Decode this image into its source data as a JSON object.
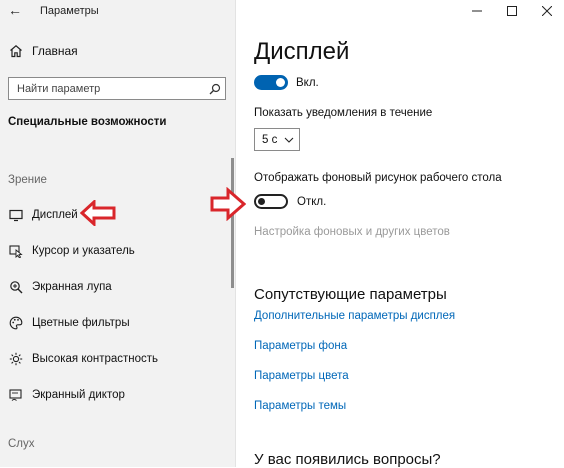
{
  "window": {
    "title": "Параметры",
    "back_glyph": "←"
  },
  "sidebar": {
    "home_label": "Главная",
    "search_placeholder": "Найти параметр",
    "section_heading": "Специальные возможности",
    "groups": [
      {
        "label": "Зрение"
      },
      {
        "label": "Слух"
      }
    ],
    "items": [
      {
        "label": "Дисплей",
        "icon": "monitor-icon"
      },
      {
        "label": "Курсор и указатель",
        "icon": "cursor-icon"
      },
      {
        "label": "Экранная лупа",
        "icon": "magnifier-icon"
      },
      {
        "label": "Цветные фильтры",
        "icon": "palette-icon"
      },
      {
        "label": "Высокая контрастность",
        "icon": "brightness-icon"
      },
      {
        "label": "Экранный диктор",
        "icon": "narrator-icon"
      }
    ]
  },
  "main": {
    "title": "Дисплей",
    "toggle1": {
      "label": "Вкл.",
      "state": "on"
    },
    "notify_label": "Показать уведомления в течение",
    "notify_select": {
      "value": "5 с"
    },
    "bg_label": "Отображать фоновый рисунок рабочего стола",
    "toggle2": {
      "label": "Откл.",
      "state": "off"
    },
    "bg_colors_link": "Настройка фоновых и других цветов",
    "related_heading": "Сопутствующие параметры",
    "links": [
      "Дополнительные параметры дисплея",
      "Параметры фона",
      "Параметры цвета",
      "Параметры темы"
    ],
    "questions_heading": "У вас появились вопросы?"
  },
  "colors": {
    "accent": "#0067b8",
    "toggle_on": "#0063b1",
    "annotation_arrow": "#d9262b",
    "sidebar_bg": "#f2f2f2"
  }
}
